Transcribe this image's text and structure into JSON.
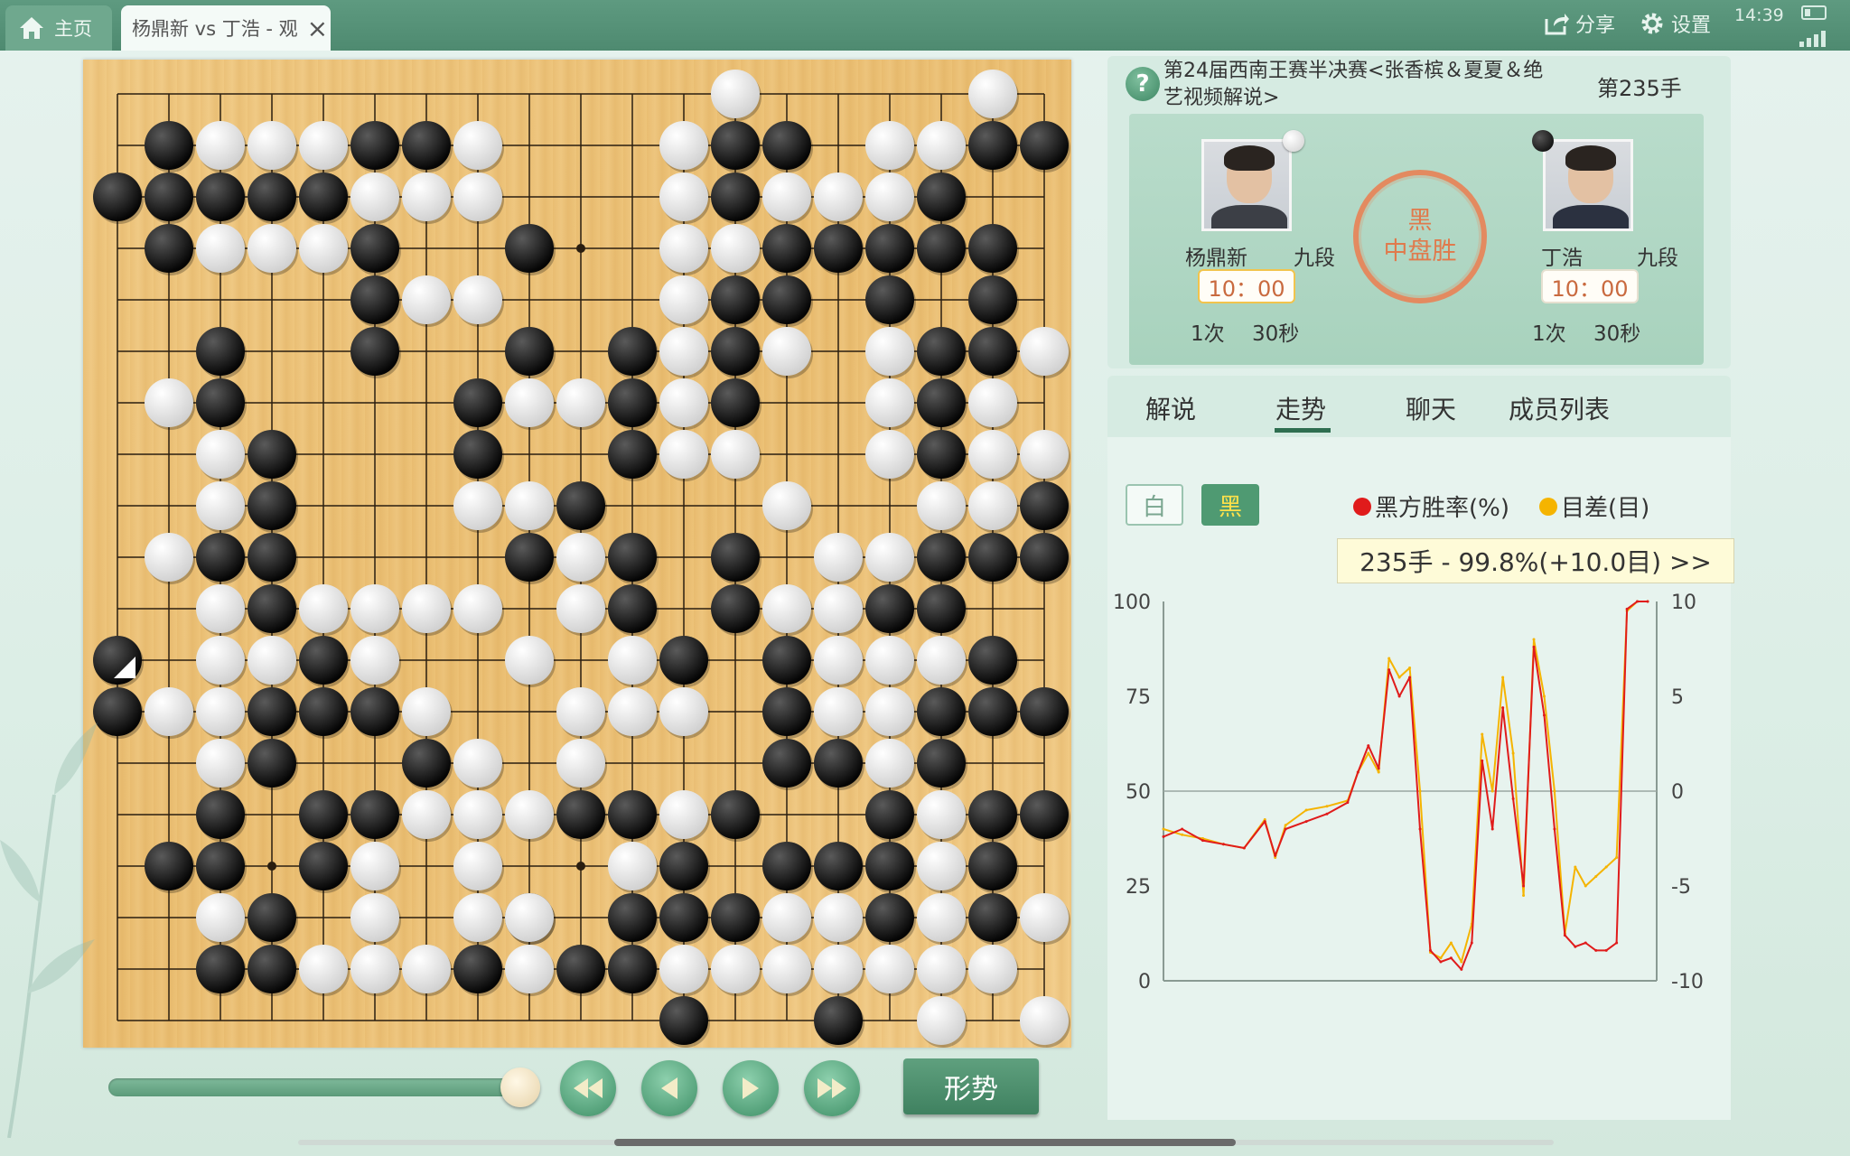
{
  "topbar": {
    "home_tab": "主页",
    "game_tab": "杨鼎新 vs 丁浩 - 观",
    "share": "分享",
    "settings": "设置",
    "time": "14:39"
  },
  "match": {
    "title": "第24届西南王赛半决赛<张香槟＆夏夏＆绝艺视频解说>",
    "move_label": "第235手",
    "result_line1": "黑",
    "result_line2": "中盘胜",
    "white_player": {
      "name": "杨鼎新",
      "rank": "九段",
      "time": "10：00",
      "byoyomi_count": "1次",
      "byoyomi_time": "30秒"
    },
    "black_player": {
      "name": "丁浩",
      "rank": "九段",
      "time": "10：00",
      "byoyomi_count": "1次",
      "byoyomi_time": "30秒"
    }
  },
  "tabs": [
    "解说",
    "走势",
    "聊天",
    "成员列表"
  ],
  "active_tab": "走势",
  "controls": {
    "situation_button": "形势"
  },
  "board": {
    "size": 19,
    "hoshi": [
      [
        3,
        3
      ],
      [
        3,
        9
      ],
      [
        3,
        15
      ],
      [
        9,
        3
      ],
      [
        9,
        9
      ],
      [
        9,
        15
      ],
      [
        15,
        3
      ],
      [
        15,
        9
      ],
      [
        15,
        15
      ]
    ],
    "last_move": [
      11,
      0
    ],
    "rows": [
      "...........W....W..",
      ".BWWWBBW...WBB..WWBB",
      "BBBBBWWW...WBWWWB..",
      ".BWWWB...B.WWBBBBB.",
      "....BWW....WBB..B.B.",
      "..B..B...B.BWBW..WBBW",
      ".WB......BWWBWB...WBW",
      "..WB.....B..BWW...WBWW",
      "..WB.....WWB...W...WWB",
      ".WBB.....BWB.B.WW.BBB",
      "..WB.WWWW..WB.BWW.BB.",
      "B.WWBW...W.WB.BWWWB.",
      "BWWBBBW...WWW.BWWBBB",
      "..WB...BW..W..BBWB..",
      "..B.BBWWWBBWB....BWBB",
      ".BB.BW..W..W.BBBB.WB.",
      "..WBW.WWB.BBBWWBWBW",
      "..BBWWWBWBBWWWWWWW.",
      "............B..B.W..W"
    ],
    "stones": {
      "black": [
        [
          1,
          1
        ],
        [
          1,
          5
        ],
        [
          1,
          6
        ],
        [
          1,
          12
        ],
        [
          1,
          13
        ],
        [
          1,
          17
        ],
        [
          1,
          18
        ],
        [
          2,
          0
        ],
        [
          2,
          1
        ],
        [
          2,
          2
        ],
        [
          2,
          3
        ],
        [
          2,
          4
        ],
        [
          2,
          12
        ],
        [
          2,
          16
        ],
        [
          3,
          1
        ],
        [
          3,
          5
        ],
        [
          3,
          8
        ],
        [
          3,
          13
        ],
        [
          3,
          14
        ],
        [
          3,
          15
        ],
        [
          3,
          16
        ],
        [
          3,
          17
        ],
        [
          4,
          5
        ],
        [
          4,
          12
        ],
        [
          4,
          13
        ],
        [
          4,
          15
        ],
        [
          4,
          17
        ],
        [
          5,
          2
        ],
        [
          5,
          5
        ],
        [
          5,
          8
        ],
        [
          5,
          10
        ],
        [
          5,
          12
        ],
        [
          5,
          16
        ],
        [
          5,
          17
        ],
        [
          6,
          2
        ],
        [
          6,
          7
        ],
        [
          6,
          10
        ],
        [
          6,
          12
        ],
        [
          6,
          16
        ],
        [
          7,
          3
        ],
        [
          7,
          7
        ],
        [
          7,
          10
        ],
        [
          7,
          16
        ],
        [
          8,
          3
        ],
        [
          8,
          9
        ],
        [
          8,
          18
        ],
        [
          9,
          2
        ],
        [
          9,
          3
        ],
        [
          9,
          8
        ],
        [
          9,
          10
        ],
        [
          9,
          12
        ],
        [
          9,
          16
        ],
        [
          9,
          17
        ],
        [
          9,
          18
        ],
        [
          10,
          3
        ],
        [
          10,
          10
        ],
        [
          10,
          12
        ],
        [
          10,
          15
        ],
        [
          10,
          16
        ],
        [
          11,
          0
        ],
        [
          11,
          4
        ],
        [
          11,
          11
        ],
        [
          11,
          13
        ],
        [
          11,
          17
        ],
        [
          12,
          0
        ],
        [
          12,
          3
        ],
        [
          12,
          4
        ],
        [
          12,
          5
        ],
        [
          12,
          13
        ],
        [
          12,
          16
        ],
        [
          12,
          17
        ],
        [
          12,
          18
        ],
        [
          13,
          3
        ],
        [
          13,
          6
        ],
        [
          13,
          13
        ],
        [
          13,
          14
        ],
        [
          13,
          16
        ],
        [
          14,
          2
        ],
        [
          14,
          4
        ],
        [
          14,
          5
        ],
        [
          14,
          9
        ],
        [
          14,
          10
        ],
        [
          14,
          12
        ],
        [
          14,
          15
        ],
        [
          14,
          17
        ],
        [
          14,
          18
        ],
        [
          15,
          1
        ],
        [
          15,
          2
        ],
        [
          15,
          4
        ],
        [
          15,
          11
        ],
        [
          15,
          13
        ],
        [
          15,
          14
        ],
        [
          15,
          15
        ],
        [
          15,
          17
        ],
        [
          16,
          3
        ],
        [
          16,
          8
        ],
        [
          16,
          10
        ],
        [
          16,
          11
        ],
        [
          16,
          12
        ],
        [
          16,
          15
        ],
        [
          16,
          17
        ],
        [
          17,
          2
        ],
        [
          17,
          3
        ],
        [
          17,
          7
        ],
        [
          17,
          9
        ],
        [
          17,
          10
        ],
        [
          18,
          11
        ],
        [
          18,
          14
        ]
      ],
      "white": [
        [
          0,
          12
        ],
        [
          0,
          17
        ],
        [
          1,
          2
        ],
        [
          1,
          3
        ],
        [
          1,
          4
        ],
        [
          1,
          7
        ],
        [
          1,
          11
        ],
        [
          1,
          15
        ],
        [
          1,
          16
        ],
        [
          2,
          5
        ],
        [
          2,
          6
        ],
        [
          2,
          7
        ],
        [
          2,
          11
        ],
        [
          2,
          13
        ],
        [
          2,
          14
        ],
        [
          2,
          15
        ],
        [
          3,
          2
        ],
        [
          3,
          3
        ],
        [
          3,
          4
        ],
        [
          3,
          11
        ],
        [
          3,
          12
        ],
        [
          4,
          6
        ],
        [
          4,
          7
        ],
        [
          4,
          11
        ],
        [
          5,
          11
        ],
        [
          5,
          13
        ],
        [
          5,
          15
        ],
        [
          5,
          18
        ],
        [
          6,
          1
        ],
        [
          6,
          8
        ],
        [
          6,
          9
        ],
        [
          6,
          11
        ],
        [
          6,
          15
        ],
        [
          6,
          17
        ],
        [
          7,
          2
        ],
        [
          7,
          11
        ],
        [
          7,
          12
        ],
        [
          7,
          15
        ],
        [
          7,
          17
        ],
        [
          7,
          18
        ],
        [
          8,
          2
        ],
        [
          8,
          7
        ],
        [
          8,
          8
        ],
        [
          8,
          13
        ],
        [
          8,
          16
        ],
        [
          8,
          17
        ],
        [
          9,
          1
        ],
        [
          9,
          9
        ],
        [
          9,
          14
        ],
        [
          9,
          15
        ],
        [
          10,
          2
        ],
        [
          10,
          4
        ],
        [
          10,
          5
        ],
        [
          10,
          6
        ],
        [
          10,
          7
        ],
        [
          10,
          9
        ],
        [
          10,
          13
        ],
        [
          10,
          14
        ],
        [
          11,
          2
        ],
        [
          11,
          3
        ],
        [
          11,
          5
        ],
        [
          11,
          8
        ],
        [
          11,
          10
        ],
        [
          11,
          14
        ],
        [
          11,
          15
        ],
        [
          11,
          16
        ],
        [
          12,
          1
        ],
        [
          12,
          2
        ],
        [
          12,
          6
        ],
        [
          12,
          9
        ],
        [
          12,
          10
        ],
        [
          12,
          11
        ],
        [
          12,
          14
        ],
        [
          12,
          15
        ],
        [
          13,
          2
        ],
        [
          13,
          7
        ],
        [
          13,
          9
        ],
        [
          13,
          15
        ],
        [
          14,
          6
        ],
        [
          14,
          7
        ],
        [
          14,
          8
        ],
        [
          14,
          11
        ],
        [
          14,
          16
        ],
        [
          15,
          5
        ],
        [
          15,
          7
        ],
        [
          15,
          10
        ],
        [
          15,
          16
        ],
        [
          16,
          2
        ],
        [
          16,
          5
        ],
        [
          16,
          7
        ],
        [
          16,
          8
        ],
        [
          16,
          13
        ],
        [
          16,
          14
        ],
        [
          16,
          16
        ],
        [
          16,
          18
        ],
        [
          17,
          4
        ],
        [
          17,
          5
        ],
        [
          17,
          6
        ],
        [
          17,
          8
        ],
        [
          17,
          11
        ],
        [
          17,
          12
        ],
        [
          17,
          13
        ],
        [
          17,
          14
        ],
        [
          17,
          15
        ],
        [
          17,
          16
        ],
        [
          17,
          17
        ],
        [
          18,
          16
        ],
        [
          18,
          18
        ]
      ]
    }
  },
  "trend": {
    "btn_white": "白",
    "btn_black": "黑",
    "legend_winrate": "黑方胜率(%)",
    "legend_score": "目差(目)",
    "tooltip": "235手 - 99.8%(+10.0目) >>",
    "colors": {
      "winrate": "#e01b1b",
      "score": "#f5b400"
    }
  },
  "chart_data": {
    "type": "line",
    "title": "",
    "xlabel": "",
    "ylabel": "",
    "ylim": [
      0,
      100
    ],
    "y2lim": [
      -10,
      10
    ],
    "y_ticks": [
      "100",
      "75",
      "50",
      "25",
      "0"
    ],
    "y2_ticks": [
      "10",
      "5",
      "0",
      "-5",
      "-10"
    ],
    "x": [
      1,
      10,
      20,
      30,
      40,
      50,
      55,
      60,
      70,
      80,
      90,
      95,
      100,
      105,
      110,
      115,
      120,
      125,
      130,
      135,
      140,
      145,
      150,
      155,
      160,
      165,
      170,
      175,
      180,
      185,
      190,
      195,
      200,
      205,
      210,
      215,
      220,
      225,
      230,
      235
    ],
    "series": [
      {
        "name": "黑方胜率(%)",
        "axis": "left",
        "values": [
          38,
          40,
          37,
          36,
          35,
          42,
          33,
          40,
          42,
          44,
          47,
          55,
          62,
          56,
          82,
          75,
          80,
          40,
          8,
          5,
          6,
          3,
          10,
          58,
          40,
          72,
          48,
          25,
          88,
          70,
          40,
          12,
          9,
          10,
          8,
          8,
          10,
          98,
          100,
          100
        ]
      },
      {
        "name": "目差(目)",
        "axis": "right",
        "values": [
          -2,
          -2.3,
          -2.5,
          -2.8,
          -3,
          -1.5,
          -3.5,
          -1.8,
          -1,
          -0.8,
          -0.5,
          1,
          2,
          1,
          7,
          6,
          6.5,
          0,
          -8.5,
          -8.8,
          -8,
          -9,
          -7,
          3,
          0,
          6,
          2,
          -5.5,
          8,
          5,
          0,
          -7.5,
          -4,
          -5,
          -4.5,
          -4,
          -3.5,
          9.5,
          10,
          10
        ]
      }
    ]
  }
}
